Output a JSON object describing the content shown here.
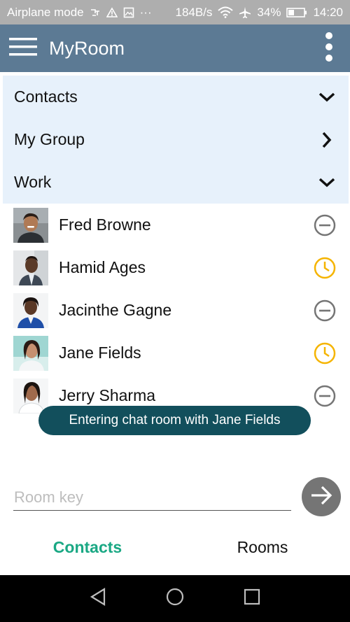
{
  "status_bar": {
    "left_text": "Airplane mode",
    "more": "···",
    "speed": "184B/s",
    "battery": "34%",
    "time": "14:20"
  },
  "app_bar": {
    "title": "MyRoom",
    "menu_icon": "hamburger-menu-icon",
    "overflow_icon": "more-vert-icon",
    "background": "#5c7a94"
  },
  "groups": [
    {
      "label": "Contacts",
      "state": "expanded",
      "icon": "chevron-down-icon"
    },
    {
      "label": "My Group",
      "state": "collapsed",
      "icon": "chevron-right-icon"
    },
    {
      "label": "Work",
      "state": "expanded",
      "icon": "chevron-down-icon"
    }
  ],
  "contacts": [
    {
      "name": "Fred Browne",
      "status": "offline",
      "status_icon": "minus-circle-icon"
    },
    {
      "name": "Hamid Ages",
      "status": "away",
      "status_icon": "clock-icon"
    },
    {
      "name": "Jacinthe Gagne",
      "status": "offline",
      "status_icon": "minus-circle-icon"
    },
    {
      "name": "Jane Fields",
      "status": "away",
      "status_icon": "clock-icon"
    },
    {
      "name": "Jerry Sharma",
      "status": "offline",
      "status_icon": "minus-circle-icon"
    }
  ],
  "toast": {
    "text": "Entering chat room with Jane Fields"
  },
  "room_key": {
    "value": "",
    "placeholder": "Room key"
  },
  "go_button_icon": "arrow-right-icon",
  "tabs": [
    {
      "label": "Contacts",
      "active": true
    },
    {
      "label": "Rooms",
      "active": false
    }
  ],
  "colors": {
    "accent": "#1aa884",
    "away": "#f5b400",
    "offline": "#757575",
    "toast": "#124f5c",
    "group_bg": "#e7f1fb"
  }
}
